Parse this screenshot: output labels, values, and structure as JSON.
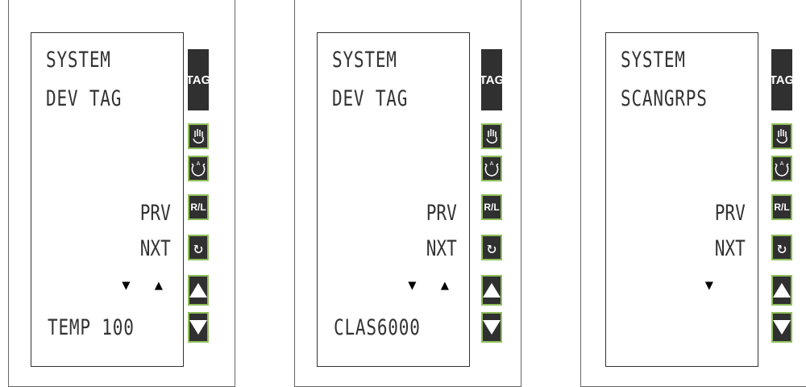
{
  "panels": [
    {
      "line1": "SYSTEM",
      "line2": "DEV TAG",
      "prv": "PRV",
      "nxt": "NXT",
      "arrows": "▼ ▲",
      "bottom": "TEMP 100"
    },
    {
      "line1": "SYSTEM",
      "line2": "DEV TAG",
      "prv": "PRV",
      "nxt": "NXT",
      "arrows": "▼ ▲",
      "bottom": "CLAS6000"
    },
    {
      "line1": "SYSTEM",
      "line2": "SCANGRPS",
      "prv": "PRV",
      "nxt": "NXT",
      "arrows": "▼",
      "bottom": ""
    }
  ],
  "buttons": {
    "tag": "TAG",
    "hand_icon": "hand-icon",
    "mode_icon": "auto-mode-icon",
    "rl": "R/L",
    "cycle_icon": "cycle-icon",
    "up_icon": "up-arrow-icon",
    "down_icon": "down-arrow-icon"
  }
}
